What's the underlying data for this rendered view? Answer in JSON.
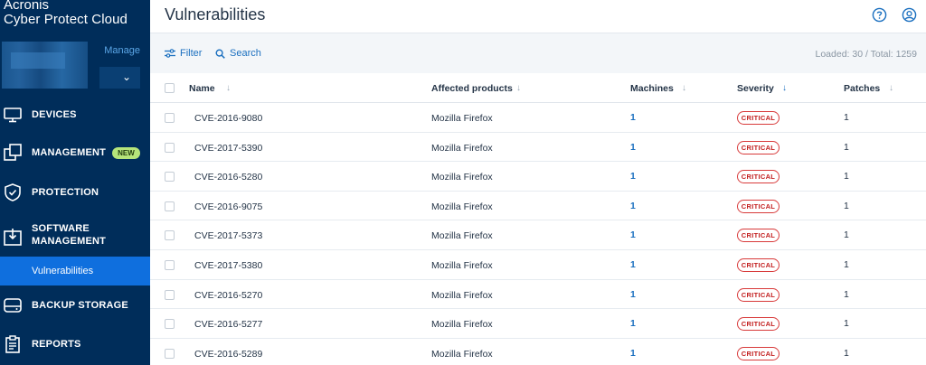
{
  "brand": {
    "line1": "Acronis",
    "line2": "Cyber Protect Cloud"
  },
  "tenant": {
    "manage_label": "Manage"
  },
  "nav": {
    "devices": "DEVICES",
    "management": "MANAGEMENT",
    "management_badge": "NEW",
    "protection": "PROTECTION",
    "software_line1": "SOFTWARE",
    "software_line2": "MANAGEMENT",
    "vulnerabilities": "Vulnerabilities",
    "backup_storage": "BACKUP STORAGE",
    "reports": "REPORTS"
  },
  "header": {
    "title": "Vulnerabilities"
  },
  "toolbar": {
    "filter_label": "Filter",
    "search_label": "Search",
    "loaded_text": "Loaded: 30 / Total: 1259"
  },
  "table": {
    "columns": {
      "name": "Name",
      "affected": "Affected products",
      "machines": "Machines",
      "severity": "Severity",
      "patches": "Patches"
    },
    "rows": [
      {
        "name": "CVE-2016-9080",
        "product": "Mozilla Firefox",
        "machines": "1",
        "severity": "CRITICAL",
        "patches": "1"
      },
      {
        "name": "CVE-2017-5390",
        "product": "Mozilla Firefox",
        "machines": "1",
        "severity": "CRITICAL",
        "patches": "1"
      },
      {
        "name": "CVE-2016-5280",
        "product": "Mozilla Firefox",
        "machines": "1",
        "severity": "CRITICAL",
        "patches": "1"
      },
      {
        "name": "CVE-2016-9075",
        "product": "Mozilla Firefox",
        "machines": "1",
        "severity": "CRITICAL",
        "patches": "1"
      },
      {
        "name": "CVE-2017-5373",
        "product": "Mozilla Firefox",
        "machines": "1",
        "severity": "CRITICAL",
        "patches": "1"
      },
      {
        "name": "CVE-2017-5380",
        "product": "Mozilla Firefox",
        "machines": "1",
        "severity": "CRITICAL",
        "patches": "1"
      },
      {
        "name": "CVE-2016-5270",
        "product": "Mozilla Firefox",
        "machines": "1",
        "severity": "CRITICAL",
        "patches": "1"
      },
      {
        "name": "CVE-2016-5277",
        "product": "Mozilla Firefox",
        "machines": "1",
        "severity": "CRITICAL",
        "patches": "1"
      },
      {
        "name": "CVE-2016-5289",
        "product": "Mozilla Firefox",
        "machines": "1",
        "severity": "CRITICAL",
        "patches": "1"
      }
    ]
  },
  "colors": {
    "sidebar": "#002d5a",
    "active_nav": "#0f6fde",
    "accent": "#1a6fbf",
    "critical": "#c21e1e",
    "badge_new": "#b6e57a"
  },
  "icons": [
    "devices-icon",
    "management-icon",
    "protection-icon",
    "software-management-icon",
    "backup-storage-icon",
    "reports-icon",
    "help-icon",
    "account-icon",
    "filter-icon",
    "search-icon",
    "chevron-down-icon"
  ]
}
